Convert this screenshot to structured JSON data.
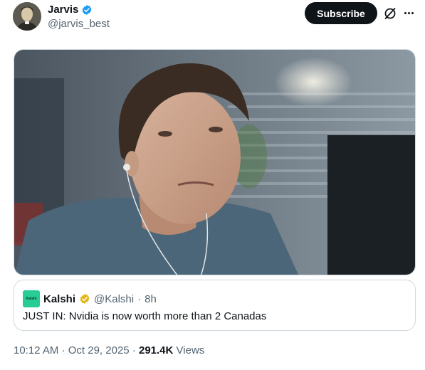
{
  "author": {
    "name": "Jarvis",
    "handle": "@jarvis_best",
    "verified_color": "#1d9bf0"
  },
  "actions": {
    "subscribe_label": "Subscribe",
    "grok_icon": "grok-slash-circle-icon",
    "more_icon": "ellipsis-icon"
  },
  "media": {
    "kind": "photo",
    "icon": "photo-image"
  },
  "quote": {
    "logo_text": "Kalshi",
    "logo_color": "#28cc95",
    "name": "Kalshi",
    "badge_color": "#e2b719",
    "handle": "@Kalshi",
    "separator": "·",
    "time": "8h",
    "text": "JUST IN: Nvidia is now worth more than 2 Canadas"
  },
  "footer": {
    "time": "10:12 AM",
    "separator": "·",
    "date": "Oct 29, 2025",
    "views_count": "291.4K",
    "views_label": "Views"
  }
}
